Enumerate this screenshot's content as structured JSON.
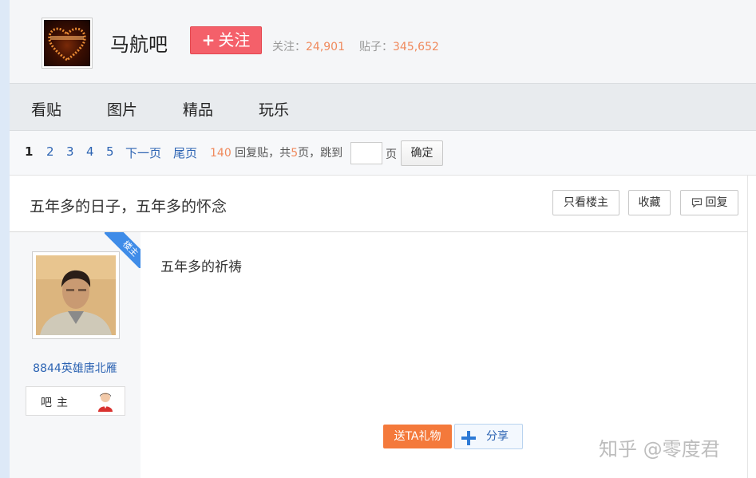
{
  "header": {
    "forum_name": "马航吧",
    "follow_label": "关注",
    "stats": {
      "followers_label": "关注：",
      "followers": "24,901",
      "posts_label": "贴子：",
      "posts": "345,652"
    }
  },
  "nav": {
    "tabs": [
      "看贴",
      "图片",
      "精品",
      "玩乐"
    ]
  },
  "pagination": {
    "current": "1",
    "pages": [
      "2",
      "3",
      "4",
      "5"
    ],
    "next": "下一页",
    "last": "尾页",
    "reply_count": "140",
    "reply_label": " 回复贴，共",
    "total_pages": "5",
    "total_suffix": "页，",
    "jump_label": "跳到",
    "jump_unit": "页",
    "confirm": "确定"
  },
  "thread": {
    "title": "五年多的日子，五年多的怀念",
    "buttons": {
      "only_op": "只看楼主",
      "collect": "收藏",
      "reply": "回复"
    }
  },
  "post": {
    "op_badge": "楼主",
    "author_name": "8844英雄唐北雁",
    "role": "吧主",
    "content": "五年多的祈祷",
    "gift_label": "送TA礼物",
    "share_label": "分享"
  },
  "watermark": "知乎 @零度君",
  "colors": {
    "accent_blue": "#2d64b3",
    "follow_red": "#f4606a",
    "gift_orange": "#f4793b",
    "stat_orange": "#f08a5d"
  }
}
